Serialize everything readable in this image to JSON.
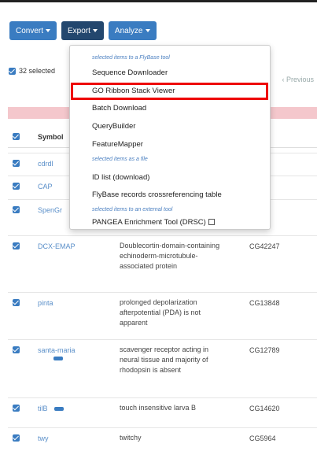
{
  "toolbar": {
    "convert_label": "Convert",
    "export_label": "Export",
    "analyze_label": "Analyze"
  },
  "selection": {
    "count_label": "32 selected"
  },
  "pagination": {
    "previous_label": "Previous"
  },
  "table": {
    "headers": {
      "symbol": "Symbol",
      "id": "ion ID"
    },
    "rows": [
      {
        "symbol": "cdrdl",
        "name": "",
        "id": ""
      },
      {
        "symbol": "CAP",
        "name": "",
        "id": "8"
      },
      {
        "symbol": "SpenGr",
        "name": "",
        "id": ""
      },
      {
        "symbol": "DCX-EMAP",
        "name": "Doublecortin-domain-containing echinoderm-microtubule-associated protein",
        "id": "CG42247"
      },
      {
        "symbol": "pinta",
        "name": "prolonged depolarization afterpotential (PDA) is not apparent",
        "id": "CG13848"
      },
      {
        "symbol": "santa-maria",
        "name": "scavenger receptor acting in neural tissue and majority of rhodopsin is absent",
        "id": "CG12789"
      },
      {
        "symbol": "tilB",
        "name": "touch insensitive larva B",
        "id": "CG14620"
      },
      {
        "symbol": "twy",
        "name": "twitchy",
        "id": "CG5964"
      }
    ]
  },
  "export_menu": {
    "section1_header": "selected items to a FlyBase tool",
    "item_sequence_downloader": "Sequence Downloader",
    "item_go_ribbon": "GO Ribbon Stack Viewer",
    "item_batch_download": "Batch Download",
    "item_querybuilder": "QueryBuilder",
    "item_featuremapper": "FeatureMapper",
    "section2_header": "selected items as a file",
    "item_id_list": "ID list (download)",
    "item_xref_table": "FlyBase records crossreferencing table",
    "section3_header": "selected items to an external tool",
    "item_pangea": "PANGEA Enrichment Tool (DRSC)"
  },
  "colors": {
    "primary": "#3a7cc1",
    "active": "#23476e",
    "highlight_border": "#e00000"
  }
}
